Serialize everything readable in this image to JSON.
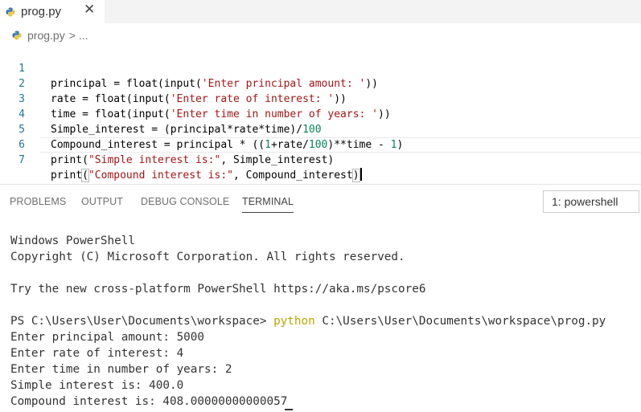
{
  "tab": {
    "title": "prog.py",
    "close_label": "✕",
    "icon": "python-icon"
  },
  "breadcrumb": {
    "file": "prog.py",
    "separator": ">",
    "more": "..."
  },
  "editor": {
    "lines": [
      {
        "num": "1",
        "text": "principal = float(input('Enter principal amount: '))"
      },
      {
        "num": "2",
        "text": "rate = float(input('Enter rate of interest: '))"
      },
      {
        "num": "3",
        "text": "time = float(input('Enter time in number of years: '))"
      },
      {
        "num": "4",
        "text": "Simple_interest = (principal*rate*time)/100"
      },
      {
        "num": "5",
        "text": "Compound_interest = principal * ((1+rate/100)**time - 1)"
      },
      {
        "num": "6",
        "text": "print(\"Simple interest is:\", Simple_interest)"
      },
      {
        "num": "7",
        "text": "print(\"Compound interest is:\", Compound_interest)"
      }
    ]
  },
  "panel": {
    "tabs": [
      {
        "label": "PROBLEMS"
      },
      {
        "label": "OUTPUT"
      },
      {
        "label": "DEBUG CONSOLE"
      },
      {
        "label": "TERMINAL"
      }
    ],
    "active_tab": "TERMINAL",
    "terminal_selector": "1: powershell"
  },
  "terminal": {
    "lines": [
      "Windows PowerShell",
      "Copyright (C) Microsoft Corporation. All rights reserved.",
      "",
      "Try the new cross-platform PowerShell https://aka.ms/pscore6",
      "",
      "Enter principal amount: 5000",
      "Enter rate of interest: 4",
      "Enter time in number of years: 2",
      "Simple interest is: 400.0",
      "Compound interest is: 408.00000000000057"
    ],
    "prompt": "PS C:\\Users\\User\\Documents\\workspace> ",
    "command": "python",
    "command_args": " C:\\Users\\User\\Documents\\workspace\\prog.py"
  },
  "colors": {
    "string": "#a31515",
    "number": "#098658",
    "line_number": "#237893",
    "command": "#b8a600"
  }
}
